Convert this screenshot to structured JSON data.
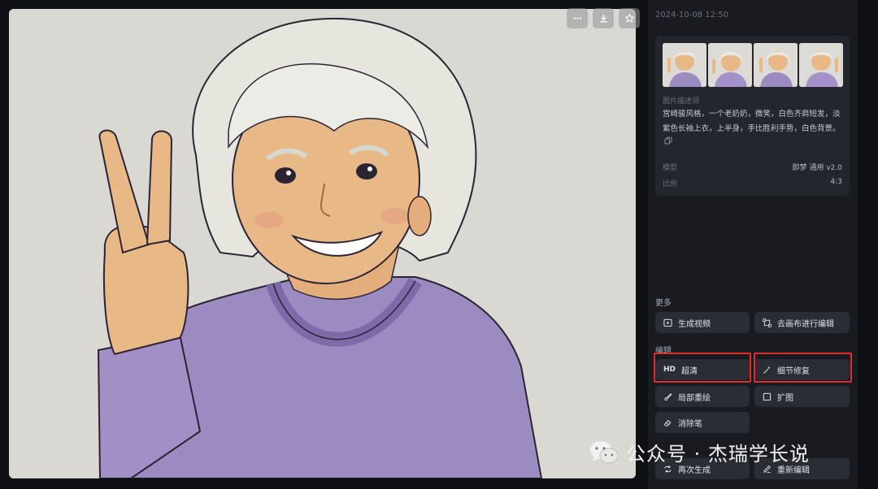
{
  "image_toolbar": {
    "more_icon": "more-dots-icon",
    "download_icon": "download-icon",
    "favorite_icon": "star-icon"
  },
  "panel": {
    "timestamp": "2024-10-08 12:50",
    "description_label": "图片描述词",
    "description_text": "宫崎骏风格，一个老奶奶，微笑，白色齐肩短发，淡紫色长袖上衣，上半身，手比胜利手势，白色背景。",
    "meta": [
      {
        "key": "模型",
        "value": "即梦 通用 v2.0"
      },
      {
        "key": "比例",
        "value": "4:3"
      }
    ],
    "more_section": {
      "label": "更多",
      "buttons": [
        {
          "label": "生成视频",
          "icon": "video-icon"
        },
        {
          "label": "去画布进行编辑",
          "icon": "canvas-icon"
        }
      ]
    },
    "edit_section": {
      "label": "编辑",
      "buttons": [
        {
          "label": "超清",
          "tag": "HD",
          "highlighted": true
        },
        {
          "label": "细节修复",
          "icon": "magic-wand-icon",
          "highlighted": true
        },
        {
          "label": "局部重绘",
          "icon": "brush-icon"
        },
        {
          "label": "扩图",
          "icon": "expand-icon"
        },
        {
          "label": "消除笔",
          "icon": "eraser-icon"
        }
      ]
    },
    "bottom_buttons": [
      {
        "label": "再次生成",
        "icon": "regenerate-icon"
      },
      {
        "label": "重新编辑",
        "icon": "edit-pen-icon"
      }
    ],
    "highlight_color": "#e22b2b"
  },
  "watermark": {
    "text": "公众号 · 杰瑞学长说",
    "icon": "wechat-icon"
  }
}
